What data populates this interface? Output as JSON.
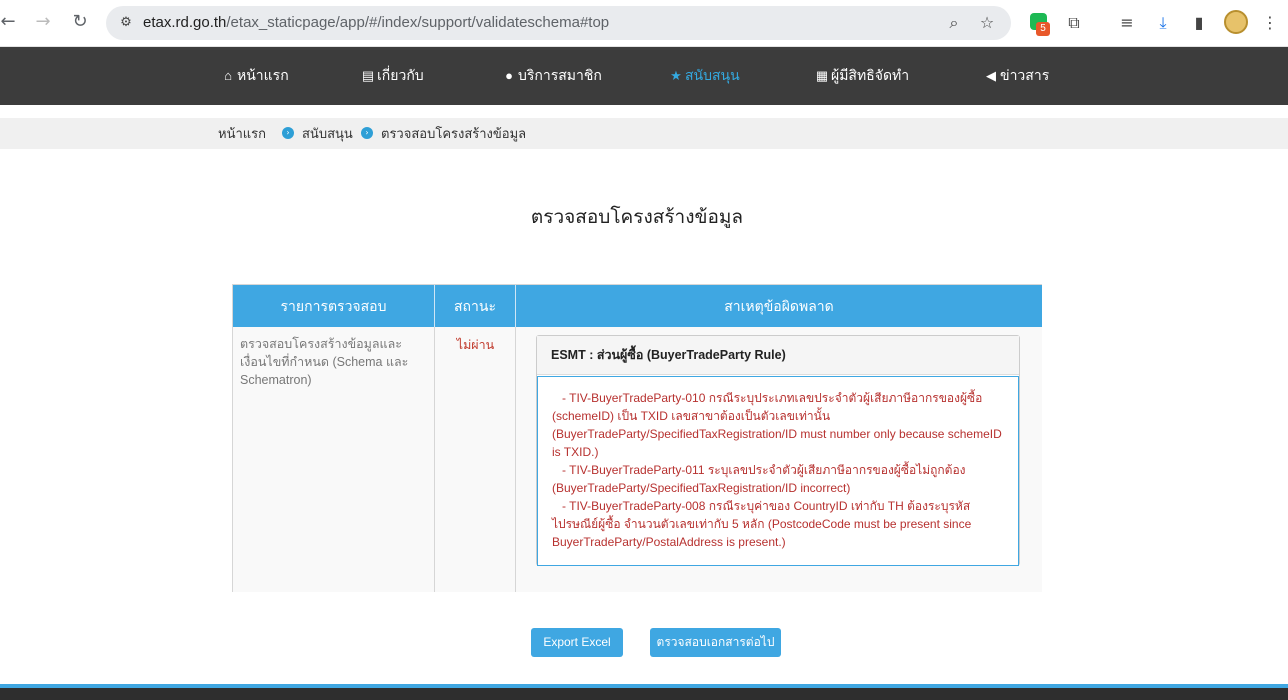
{
  "browser": {
    "url_host": "etax.rd.go.th",
    "url_path": "/etax_staticpage/app/#/index/support/validateschema#top",
    "extension_badge": "5"
  },
  "nav": {
    "items": [
      {
        "label": "หน้าแรก",
        "icon": "home-icon"
      },
      {
        "label": "เกี่ยวกับ",
        "icon": "file-icon"
      },
      {
        "label": "บริการสมาชิก",
        "icon": "user-icon"
      },
      {
        "label": "สนับสนุน",
        "icon": "star-icon",
        "active": true
      },
      {
        "label": "ผู้มีสิทธิจัดทำ",
        "icon": "book-icon"
      },
      {
        "label": "ข่าวสาร",
        "icon": "bullhorn-icon"
      }
    ]
  },
  "breadcrumb": [
    "หน้าแรก",
    "สนับสนุน",
    "ตรวจสอบโครงสร้างข้อมูล"
  ],
  "page_title": "ตรวจสอบโครงสร้างข้อมูล",
  "table": {
    "headers": [
      "รายการตรวจสอบ",
      "สถานะ",
      "สาเหตุข้อผิดพลาด"
    ],
    "row": {
      "check": "ตรวจสอบโครงสร้างข้อมูลและเงื่อนไขที่กำหนด (Schema และ Schematron)",
      "status": "ไม่ผ่าน",
      "panel_title": "ESMT : ส่วนผู้ซื้อ (BuyerTradeParty Rule)",
      "errors": [
        "   - TIV-BuyerTradeParty-010 กรณีระบุประเภทเลขประจำตัวผู้เสียภาษีอากรของผู้ซื้อ (schemeID) เป็น TXID เลขสาขาต้องเป็นตัวเลขเท่านั้น (BuyerTradeParty/SpecifiedTaxRegistration/ID must number only because schemeID is TXID.)",
        "   - TIV-BuyerTradeParty-011 ระบุเลขประจำตัวผู้เสียภาษีอากรของผู้ซื้อไม่ถูกต้อง (BuyerTradeParty/SpecifiedTaxRegistration/ID incorrect)",
        "   - TIV-BuyerTradeParty-008 กรณีระบุค่าของ CountryID เท่ากับ TH ต้องระบุรหัสไปรษณีย์ผู้ซื้อ จำนวนตัวเลขเท่ากับ 5 หลัก (PostcodeCode must be present since BuyerTradeParty/PostalAddress is present.)"
      ]
    }
  },
  "buttons": {
    "export": "Export Excel",
    "next": "ตรวจสอบเอกสารต่อไป"
  },
  "colors": {
    "accent": "#3fa7e2",
    "nav_bg": "#3c3c3c",
    "error": "#b7312f"
  }
}
